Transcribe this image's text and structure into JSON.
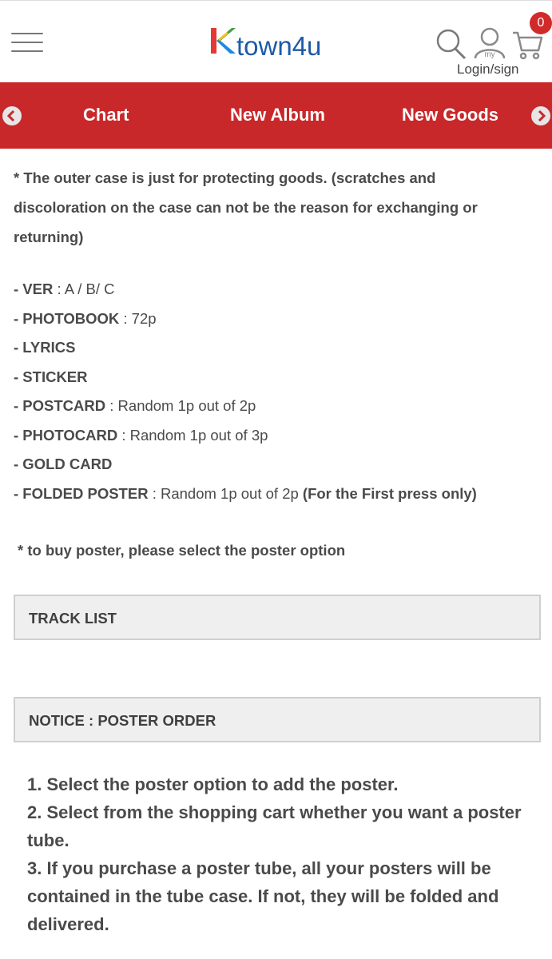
{
  "header": {
    "logo_k": "K",
    "logo_rest": "town4u",
    "login_label": "Login/sign",
    "cart_count": "0",
    "user_icon_caption": "my",
    "brand_red": "#c8282a",
    "brand_blue": "#1d5aa6"
  },
  "nav": {
    "items": [
      {
        "label": "Chart"
      },
      {
        "label": "New Album"
      },
      {
        "label": "New Goods"
      }
    ]
  },
  "content": {
    "notice": "* The outer case is just for protecting goods. (scratches and discoloration on the case can not be the reason for exchanging or returning)",
    "specs": [
      {
        "key": "- VER",
        "value": " : A /  B/  C",
        "extra": ""
      },
      {
        "key": "- PHOTOBOOK",
        "value": " : 72p",
        "extra": ""
      },
      {
        "key": "- LYRICS",
        "value": "",
        "extra": ""
      },
      {
        "key": "- STICKER",
        "value": "",
        "extra": ""
      },
      {
        "key": "- POSTCARD",
        "value": " : Random 1p out of 2p",
        "extra": ""
      },
      {
        "key": "- PHOTOCARD",
        "value": " : Random 1p out of 3p",
        "extra": ""
      },
      {
        "key": "- GOLD CARD",
        "value": "",
        "extra": ""
      },
      {
        "key": "- FOLDED POSTER",
        "value": " : Random 1p out of 2p ",
        "extra": "(For the First press only)"
      }
    ],
    "buy_note": "* to buy poster, please select the poster option",
    "track_list_label": "TRACK LIST",
    "notice_box_label": "NOTICE : POSTER ORDER",
    "steps": [
      "1. Select the poster option to add the poster.",
      "2. Select from the shopping cart whether you want a poster tube.",
      "3. If you purchase a poster tube, all your posters will be contained in the tube case. If not, they will be folded and delivered."
    ]
  }
}
